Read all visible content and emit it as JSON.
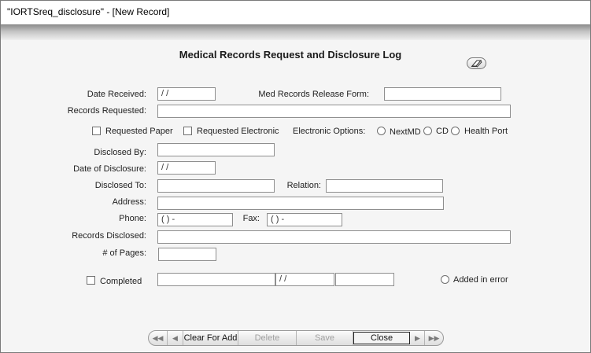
{
  "window": {
    "title": "\"IORTSreq_disclosure\" - [New Record]"
  },
  "form": {
    "heading": "Medical Records Request and Disclosure Log",
    "labels": {
      "date_received": "Date Received:",
      "release_form": "Med Records Release Form:",
      "records_requested": "Records Requested:",
      "requested_paper": "Requested Paper",
      "requested_electronic": "Requested Electronic",
      "electronic_options": "Electronic Options:",
      "nextmd": "NextMD",
      "cd": "CD",
      "health_port": "Health Port",
      "disclosed_by": "Disclosed By:",
      "date_of_disclosure": "Date of Disclosure:",
      "disclosed_to": "Disclosed To:",
      "relation": "Relation:",
      "address": "Address:",
      "phone": "Phone:",
      "fax": "Fax:",
      "records_disclosed": "Records Disclosed:",
      "num_pages": "# of Pages:",
      "completed": "Completed",
      "added_in_error": "Added in error"
    },
    "values": {
      "date_received": " /  /",
      "release_form": "",
      "records_requested": "",
      "disclosed_by": "",
      "date_of_disclosure": " /  /",
      "disclosed_to": "",
      "relation": "",
      "address": "",
      "phone": "(   )    -",
      "fax": "(   )    -",
      "records_disclosed": "",
      "num_pages": "",
      "completed_by": "",
      "completed_date": " /  /",
      "completed_extra": ""
    }
  },
  "navbar": {
    "first_icon": "first-record-icon",
    "prev_icon": "previous-record-icon",
    "clear_for_add": "Clear For Add",
    "delete": "Delete",
    "save": "Save",
    "close": "Close",
    "next_icon": "next-record-icon",
    "last_icon": "last-record-icon"
  }
}
